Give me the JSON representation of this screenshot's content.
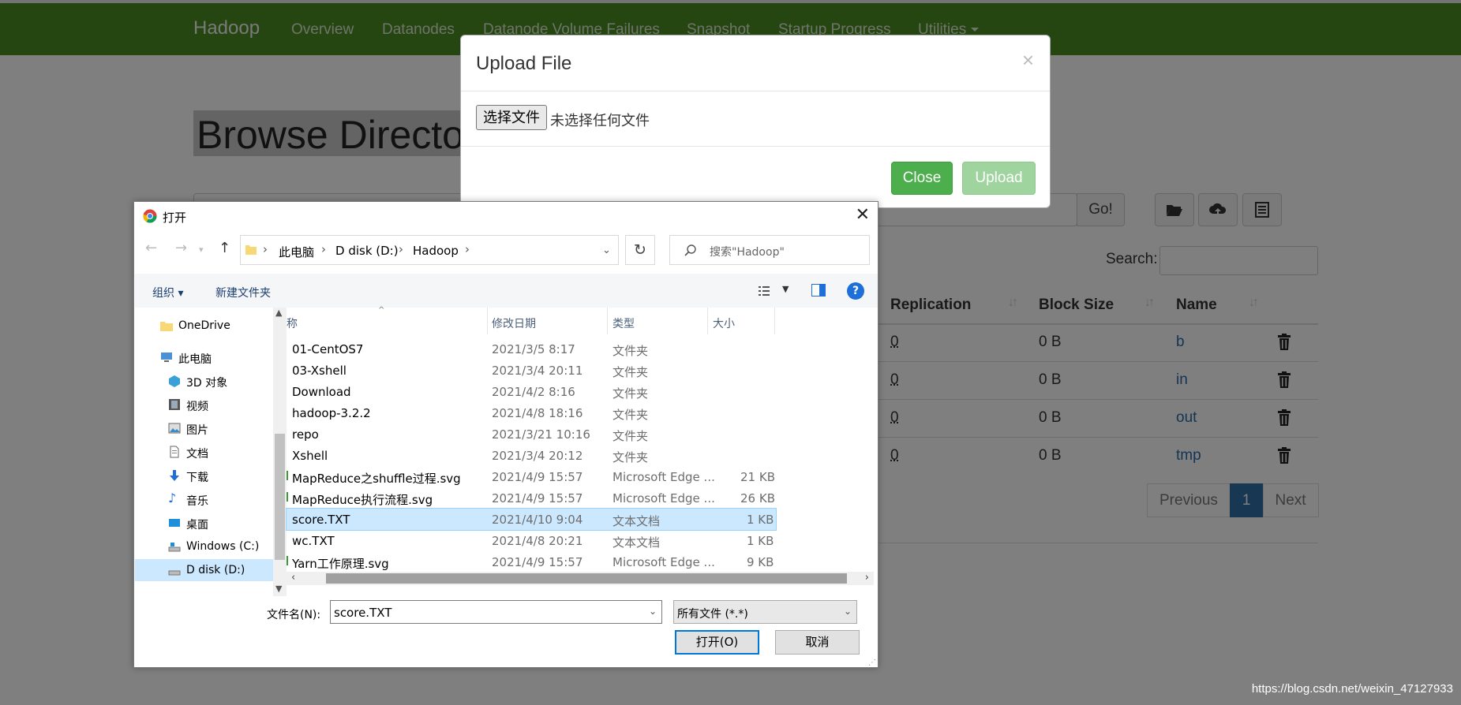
{
  "nav": {
    "brand": "Hadoop",
    "links": [
      "Overview",
      "Datanodes",
      "Datanode Volume Failures",
      "Snapshot",
      "Startup Progress",
      "Utilities"
    ]
  },
  "page": {
    "title": "Browse Director",
    "go_label": "Go!",
    "search_label": "Search:"
  },
  "table": {
    "headers": [
      "Replication",
      "Block Size",
      "Name"
    ],
    "rows": [
      {
        "replication": "0",
        "block_size": "0 B",
        "name": "b"
      },
      {
        "replication": "0",
        "block_size": "0 B",
        "name": "in"
      },
      {
        "replication": "0",
        "block_size": "0 B",
        "name": "out"
      },
      {
        "replication": "0",
        "block_size": "0 B",
        "name": "tmp"
      }
    ]
  },
  "pagination": {
    "previous": "Previous",
    "current": "1",
    "next": "Next"
  },
  "upload_modal": {
    "title": "Upload File",
    "close_x": "×",
    "choose_file": "选择文件",
    "no_file": "未选择任何文件",
    "close_label": "Close",
    "upload_label": "Upload"
  },
  "open_dialog": {
    "title": "打开",
    "close_x": "✕",
    "breadcrumbs": [
      "此电脑",
      "D disk (D:)",
      "Hadoop"
    ],
    "search_placeholder": "搜索\"Hadoop\"",
    "organize": "组织 ▾",
    "new_folder": "新建文件夹",
    "help": "?",
    "nav_items": [
      {
        "label": "OneDrive"
      },
      {
        "label": "此电脑"
      },
      {
        "label": "3D 对象"
      },
      {
        "label": "视频"
      },
      {
        "label": "图片"
      },
      {
        "label": "文档"
      },
      {
        "label": "下载"
      },
      {
        "label": "音乐"
      },
      {
        "label": "桌面"
      },
      {
        "label": "Windows (C:)"
      },
      {
        "label": "D disk (D:)"
      }
    ],
    "columns": [
      "称",
      "修改日期",
      "类型",
      "大小"
    ],
    "files": [
      {
        "name": "01-CentOS7",
        "date": "2021/3/5 8:17",
        "type": "文件夹",
        "size": ""
      },
      {
        "name": "03-Xshell",
        "date": "2021/3/4 20:11",
        "type": "文件夹",
        "size": ""
      },
      {
        "name": "Download",
        "date": "2021/4/2 8:16",
        "type": "文件夹",
        "size": ""
      },
      {
        "name": "hadoop-3.2.2",
        "date": "2021/4/8 18:16",
        "type": "文件夹",
        "size": ""
      },
      {
        "name": "repo",
        "date": "2021/3/21 10:16",
        "type": "文件夹",
        "size": ""
      },
      {
        "name": "Xshell",
        "date": "2021/3/4 20:12",
        "type": "文件夹",
        "size": ""
      },
      {
        "name": "MapReduce之shuffle过程.svg",
        "date": "2021/4/9 15:57",
        "type": "Microsoft Edge ...",
        "size": "21 KB"
      },
      {
        "name": "MapReduce执行流程.svg",
        "date": "2021/4/9 15:57",
        "type": "Microsoft Edge ...",
        "size": "26 KB"
      },
      {
        "name": "score.TXT",
        "date": "2021/4/10 9:04",
        "type": "文本文档",
        "size": "1 KB"
      },
      {
        "name": "wc.TXT",
        "date": "2021/4/8 20:21",
        "type": "文本文档",
        "size": "1 KB"
      },
      {
        "name": "Yarn工作原理.svg",
        "date": "2021/4/9 15:57",
        "type": "Microsoft Edge ...",
        "size": "9 KB"
      }
    ],
    "filename_label": "文件名(N):",
    "filename_value": "score.TXT",
    "filetype_value": "所有文件 (*.*)",
    "open_label": "打开(O)",
    "cancel_label": "取消"
  },
  "watermark": "https://blog.csdn.net/weixin_47127933",
  "colors": {
    "navbar": "#4b8d22",
    "success": "#4cae4c",
    "primary": "#2e6ea7",
    "selection": "#cce8ff"
  }
}
